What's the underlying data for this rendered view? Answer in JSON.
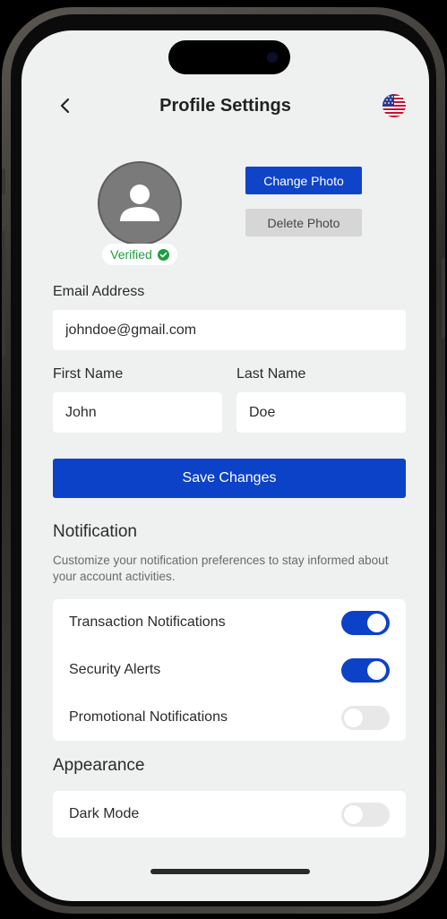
{
  "header": {
    "title": "Profile Settings",
    "back_icon": "chevron-left-icon",
    "flag_icon": "us-flag-icon"
  },
  "profile": {
    "avatar_icon": "user-icon",
    "verified_label": "Verified",
    "verified_icon": "check-circle-icon",
    "change_photo_label": "Change Photo",
    "delete_photo_label": "Delete Photo"
  },
  "form": {
    "email_label": "Email Address",
    "email_value": "johndoe@gmail.com",
    "first_name_label": "First Name",
    "first_name_value": "John",
    "last_name_label": "Last Name",
    "last_name_value": "Doe",
    "save_label": "Save Changes"
  },
  "notification": {
    "title": "Notification",
    "description": "Customize your notification preferences to stay informed about your account activities.",
    "items": [
      {
        "label": "Transaction Notifications",
        "enabled": true
      },
      {
        "label": "Security Alerts",
        "enabled": true
      },
      {
        "label": "Promotional Notifications",
        "enabled": false
      }
    ]
  },
  "appearance": {
    "title": "Appearance",
    "items": [
      {
        "label": "Dark Mode",
        "enabled": false
      }
    ]
  },
  "colors": {
    "primary": "#0c42c8",
    "verified_green": "#1e9e3e",
    "background": "#eff0f0",
    "delete_button": "#d6d6d6"
  }
}
